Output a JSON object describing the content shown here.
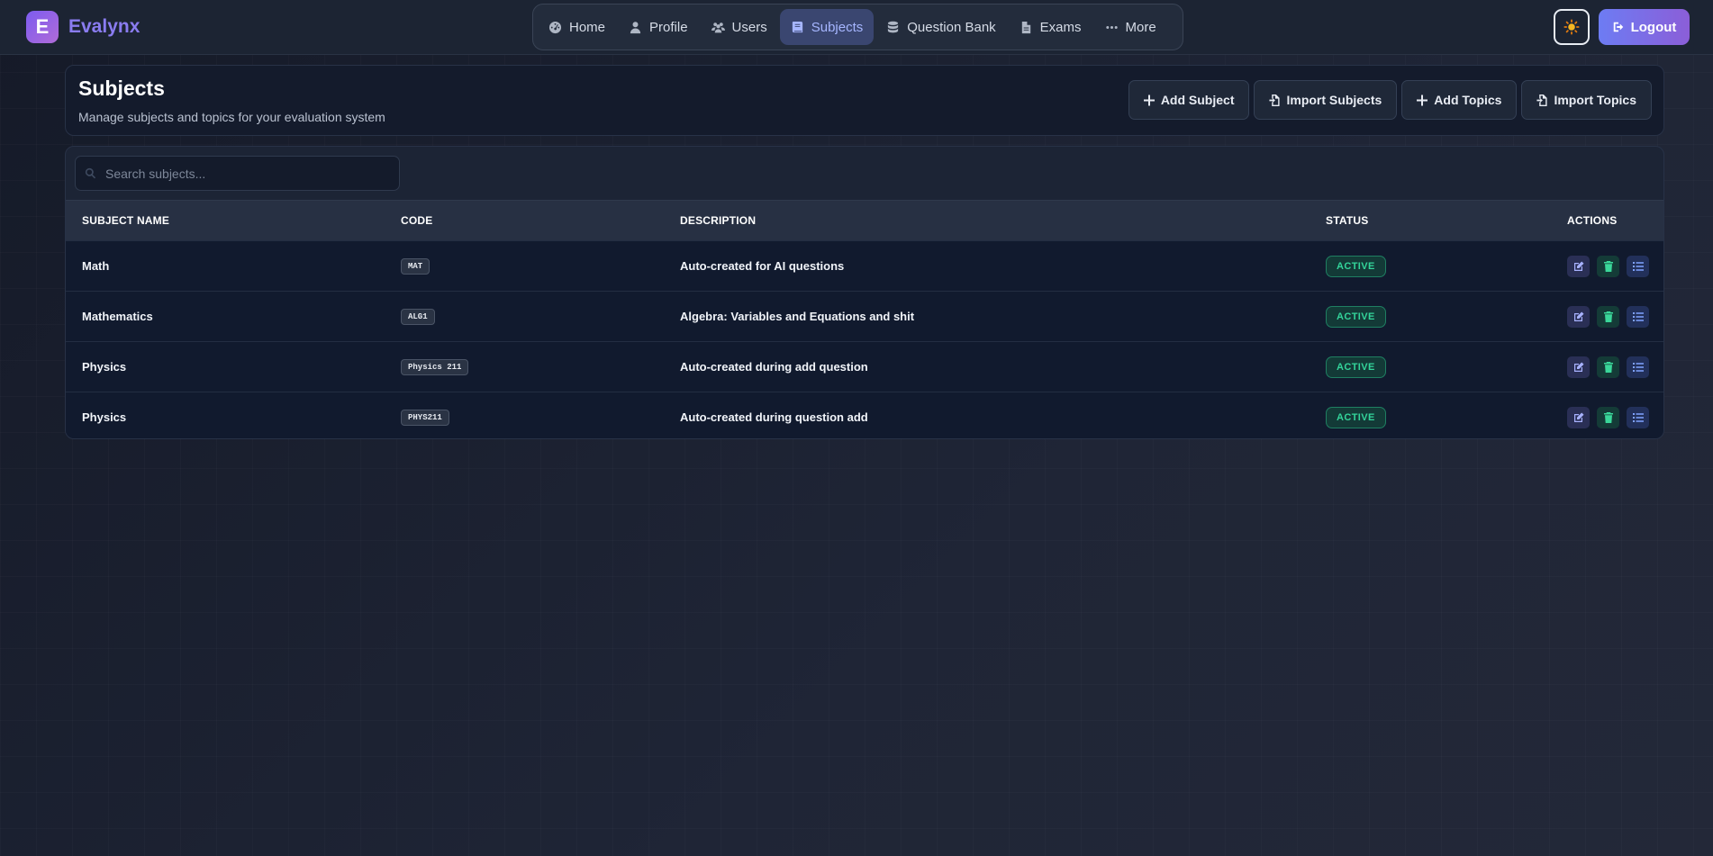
{
  "brand": {
    "logo_letter": "E",
    "name": "Evalynx"
  },
  "nav": {
    "items": [
      {
        "label": "Home",
        "icon": "gauge-icon",
        "active": false
      },
      {
        "label": "Profile",
        "icon": "user-icon",
        "active": false
      },
      {
        "label": "Users",
        "icon": "users-icon",
        "active": false
      },
      {
        "label": "Subjects",
        "icon": "book-icon",
        "active": true
      },
      {
        "label": "Question Bank",
        "icon": "database-icon",
        "active": false
      },
      {
        "label": "Exams",
        "icon": "file-icon",
        "active": false
      },
      {
        "label": "More",
        "icon": "ellipsis-icon",
        "active": false
      }
    ]
  },
  "topbar": {
    "theme_icon": "sun-icon",
    "logout_label": "Logout"
  },
  "page": {
    "title": "Subjects",
    "subtitle": "Manage subjects and topics for your evaluation system",
    "actions": {
      "add_subject": "Add Subject",
      "import_subjects": "Import Subjects",
      "add_topics": "Add Topics",
      "import_topics": "Import Topics"
    }
  },
  "search": {
    "placeholder": "Search subjects...",
    "value": ""
  },
  "table": {
    "columns": {
      "name": "SUBJECT NAME",
      "code": "CODE",
      "description": "DESCRIPTION",
      "status": "STATUS",
      "actions": "ACTIONS"
    },
    "rows": [
      {
        "name": "Math",
        "code": "MAT",
        "description": "Auto-created for AI questions",
        "status": "ACTIVE"
      },
      {
        "name": "Mathematics",
        "code": "ALG1",
        "description": "Algebra: Variables and Equations and shit",
        "status": "ACTIVE"
      },
      {
        "name": "Physics",
        "code": "Physics 211",
        "description": "Auto-created during add question",
        "status": "ACTIVE"
      },
      {
        "name": "Physics",
        "code": "PHYS211",
        "description": "Auto-created during question add",
        "status": "ACTIVE"
      }
    ]
  },
  "colors": {
    "accent": "#8a7cf0",
    "active_nav": "#3a4670",
    "status_active": "#33d49a"
  }
}
